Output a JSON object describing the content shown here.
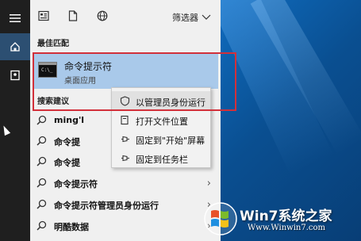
{
  "colors": {
    "panel_bg": "#f0f0f0",
    "rail_bg": "#1f1f1f",
    "best_match_bg": "#a9c9ea",
    "highlight_border": "#d2303a",
    "desktop_blue": "#0a5fa8"
  },
  "rail": {
    "icons": [
      "hamburger-icon",
      "home-icon",
      "contact-card-icon"
    ]
  },
  "topbar": {
    "icons": [
      "apps-icon",
      "document-icon",
      "globe-icon"
    ],
    "filter_label": "筛选器"
  },
  "sections": {
    "best_match": "最佳匹配",
    "suggestions": "搜索建议"
  },
  "best_match": {
    "title": "命令提示符",
    "subtitle": "桌面应用",
    "icon_text": "C:\\_"
  },
  "suggestions": [
    {
      "label": "ming'l"
    },
    {
      "label": "命令提"
    },
    {
      "label": "命令提"
    },
    {
      "label": "命令提示符"
    },
    {
      "label": "命令提示符管理员身份运行"
    },
    {
      "label": "明酷数据"
    }
  ],
  "context_menu": {
    "items": [
      {
        "label": "以管理员身份运行",
        "icon": "shield-icon"
      },
      {
        "label": "打开文件位置",
        "icon": "folder-icon"
      },
      {
        "label": "固定到\"开始\"屏幕",
        "icon": "pin-icon"
      },
      {
        "label": "固定到任务栏",
        "icon": "pin-icon"
      }
    ]
  },
  "watermark": {
    "title": "Win7系统之家",
    "url": "Www.Winwin7.com"
  }
}
